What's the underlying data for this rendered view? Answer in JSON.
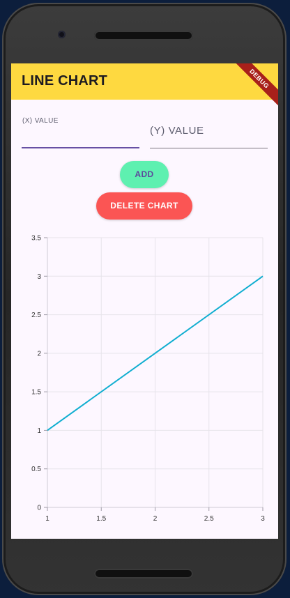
{
  "app": {
    "title": "LINE CHART",
    "debug_banner": "DEBUG"
  },
  "inputs": {
    "x": {
      "label": "(X) VALUE",
      "value": ""
    },
    "y": {
      "placeholder": "(Y) VALUE",
      "value": ""
    }
  },
  "buttons": {
    "add_label": "ADD",
    "delete_label": "DELETE CHART"
  },
  "colors": {
    "appbar": "#fed940",
    "add": "#5ef0b0",
    "delete": "#fb5554",
    "line": "#10aed0"
  },
  "chart_data": {
    "type": "line",
    "x": [
      1,
      3
    ],
    "series": [
      {
        "values": [
          1,
          3
        ]
      }
    ],
    "xlim": [
      1,
      3
    ],
    "ylim": [
      0,
      3.5
    ],
    "xticks": [
      1,
      1.5,
      2,
      2.5,
      3
    ],
    "yticks": [
      0,
      0.5,
      1,
      1.5,
      2,
      2.5,
      3,
      3.5
    ],
    "xtick_labels": [
      "1",
      "1.5",
      "2",
      "2.5",
      "3"
    ],
    "ytick_labels": [
      "0",
      "0.5",
      "1",
      "1.5",
      "2",
      "2.5",
      "3",
      "3.5"
    ],
    "grid": true
  }
}
